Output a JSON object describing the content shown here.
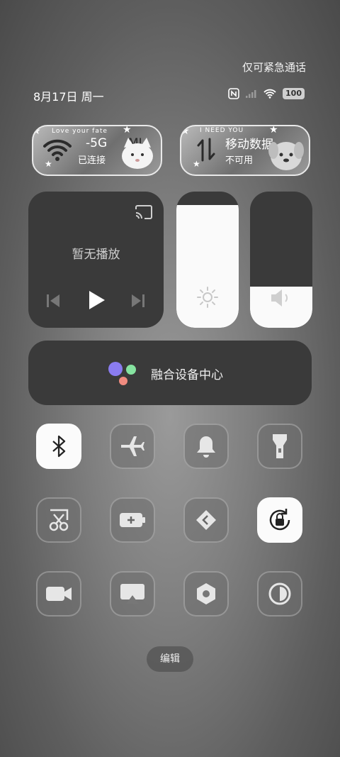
{
  "header": {
    "emergency_text": "仅可紧急通话",
    "date": "8月17日 周一",
    "battery": "100"
  },
  "wifi_card": {
    "decor_text": "Love your fate",
    "network": "-5G",
    "network_suffix": "MI",
    "status": "已连接"
  },
  "mobile_card": {
    "decor_text": "I NEED YOU",
    "title": "移动数据",
    "status": "不可用"
  },
  "media": {
    "label": "暂无播放"
  },
  "sliders": {
    "brightness_level": 0.9,
    "volume_level": 0.3
  },
  "fusion": {
    "label": "融合设备中心"
  },
  "toggles": [
    {
      "name": "bluetooth",
      "icon": "bluetooth-icon",
      "on": true
    },
    {
      "name": "airplane",
      "icon": "airplane-icon",
      "on": false
    },
    {
      "name": "sound",
      "icon": "bell-icon",
      "on": false
    },
    {
      "name": "flashlight",
      "icon": "flashlight-icon",
      "on": false
    },
    {
      "name": "screenshot",
      "icon": "scissors-icon",
      "on": false
    },
    {
      "name": "battery-saver",
      "icon": "battery-plus-icon",
      "on": false
    },
    {
      "name": "nearby-share",
      "icon": "share-arrows-icon",
      "on": false
    },
    {
      "name": "rotation-lock",
      "icon": "rotation-lock-icon",
      "on": true
    },
    {
      "name": "screen-record",
      "icon": "video-camera-icon",
      "on": false
    },
    {
      "name": "cast",
      "icon": "cast-screen-icon",
      "on": false
    },
    {
      "name": "settings",
      "icon": "gear-icon",
      "on": false
    },
    {
      "name": "dark-mode",
      "icon": "contrast-icon",
      "on": false
    }
  ],
  "edit_label": "编辑",
  "colors": {
    "panel": "#3a3a3a",
    "tile_on": "#fbfbfb",
    "fusion_dot_purple": "#8a7cf0",
    "fusion_dot_green": "#86e3a0",
    "fusion_dot_red": "#f08b7f"
  }
}
